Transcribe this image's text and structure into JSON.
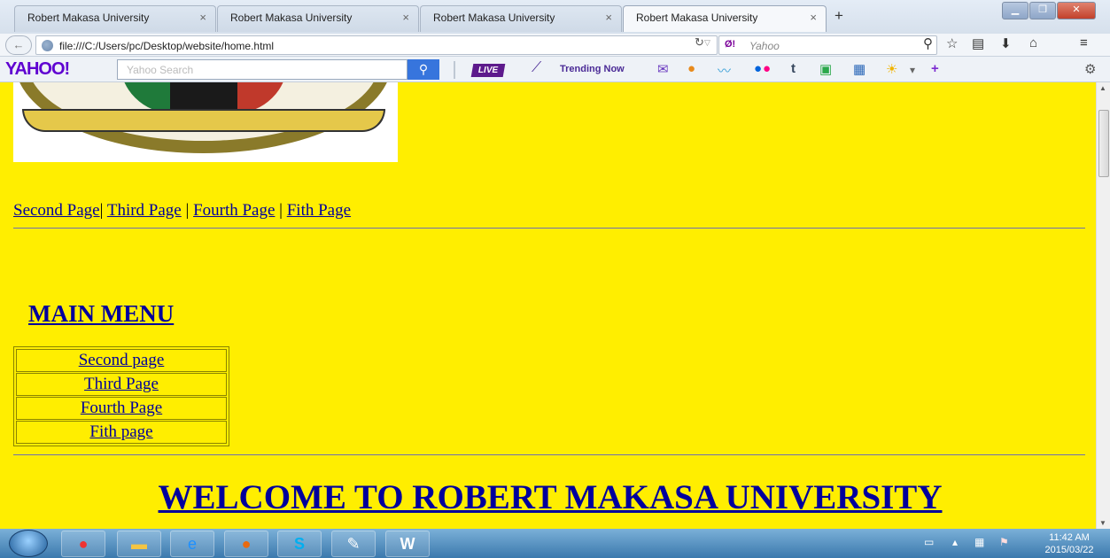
{
  "browser": {
    "tabs": [
      {
        "label": "Robert Makasa University",
        "active": false
      },
      {
        "label": "Robert Makasa University",
        "active": false
      },
      {
        "label": "Robert Makasa University",
        "active": false
      },
      {
        "label": "Robert Makasa University",
        "active": true
      }
    ],
    "tab_close_glyph": "×",
    "new_tab_glyph": "+",
    "url": "file:///C:/Users/pc/Desktop/website/home.html",
    "search_engine_logo": "Ø!",
    "search_placeholder": "Yahoo"
  },
  "yahoo_toolbar": {
    "logo": "YAHOO!",
    "search_placeholder": "Yahoo Search",
    "live_label": "LIVE",
    "trending_label": "Trending Now"
  },
  "page": {
    "top_links": [
      "Second Page",
      "Third Page",
      "Fourth Page",
      "Fith Page"
    ],
    "main_menu_title": "MAIN MENU",
    "menu_items": [
      "Second page",
      "Third Page",
      "Fourth Page",
      "Fith page"
    ],
    "welcome": "WELCOME TO ROBERT MAKASA UNIVERSITY",
    "background_color": "#ffee00",
    "link_color": "#00009c"
  },
  "taskbar": {
    "time": "11:42 AM",
    "date": "2015/03/22"
  }
}
